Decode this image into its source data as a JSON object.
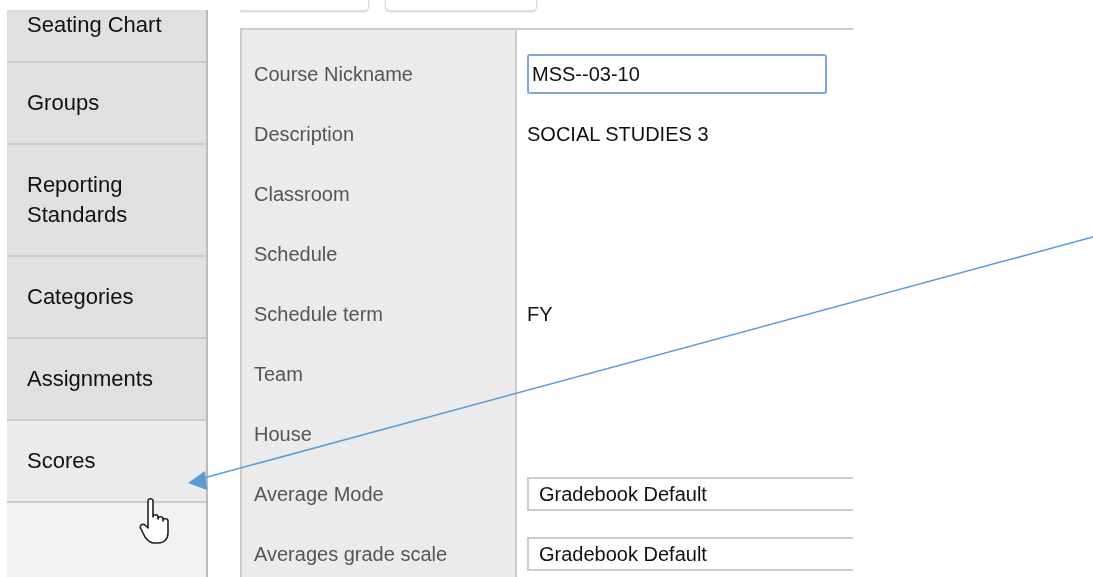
{
  "sidebar": {
    "items": [
      {
        "label": "Seating Chart",
        "selected": false
      },
      {
        "label": "Groups",
        "selected": false
      },
      {
        "label": "Reporting Standards",
        "selected": false
      },
      {
        "label": "Categories",
        "selected": false
      },
      {
        "label": "Assignments",
        "selected": false
      },
      {
        "label": "Scores",
        "selected": true
      }
    ]
  },
  "form": {
    "fields": [
      {
        "label": "Course Nickname",
        "kind": "input",
        "value": "MSS--03-10"
      },
      {
        "label": "Description",
        "kind": "text",
        "value": "SOCIAL STUDIES 3"
      },
      {
        "label": "Classroom",
        "kind": "empty"
      },
      {
        "label": "Schedule",
        "kind": "empty"
      },
      {
        "label": "Schedule term",
        "kind": "text",
        "value": "FY"
      },
      {
        "label": "Team",
        "kind": "empty"
      },
      {
        "label": "House",
        "kind": "empty"
      },
      {
        "label": "Average Mode",
        "kind": "select",
        "value": "Gradebook Default"
      },
      {
        "label": "Averages grade scale",
        "kind": "select",
        "value": "Gradebook Default"
      }
    ]
  }
}
